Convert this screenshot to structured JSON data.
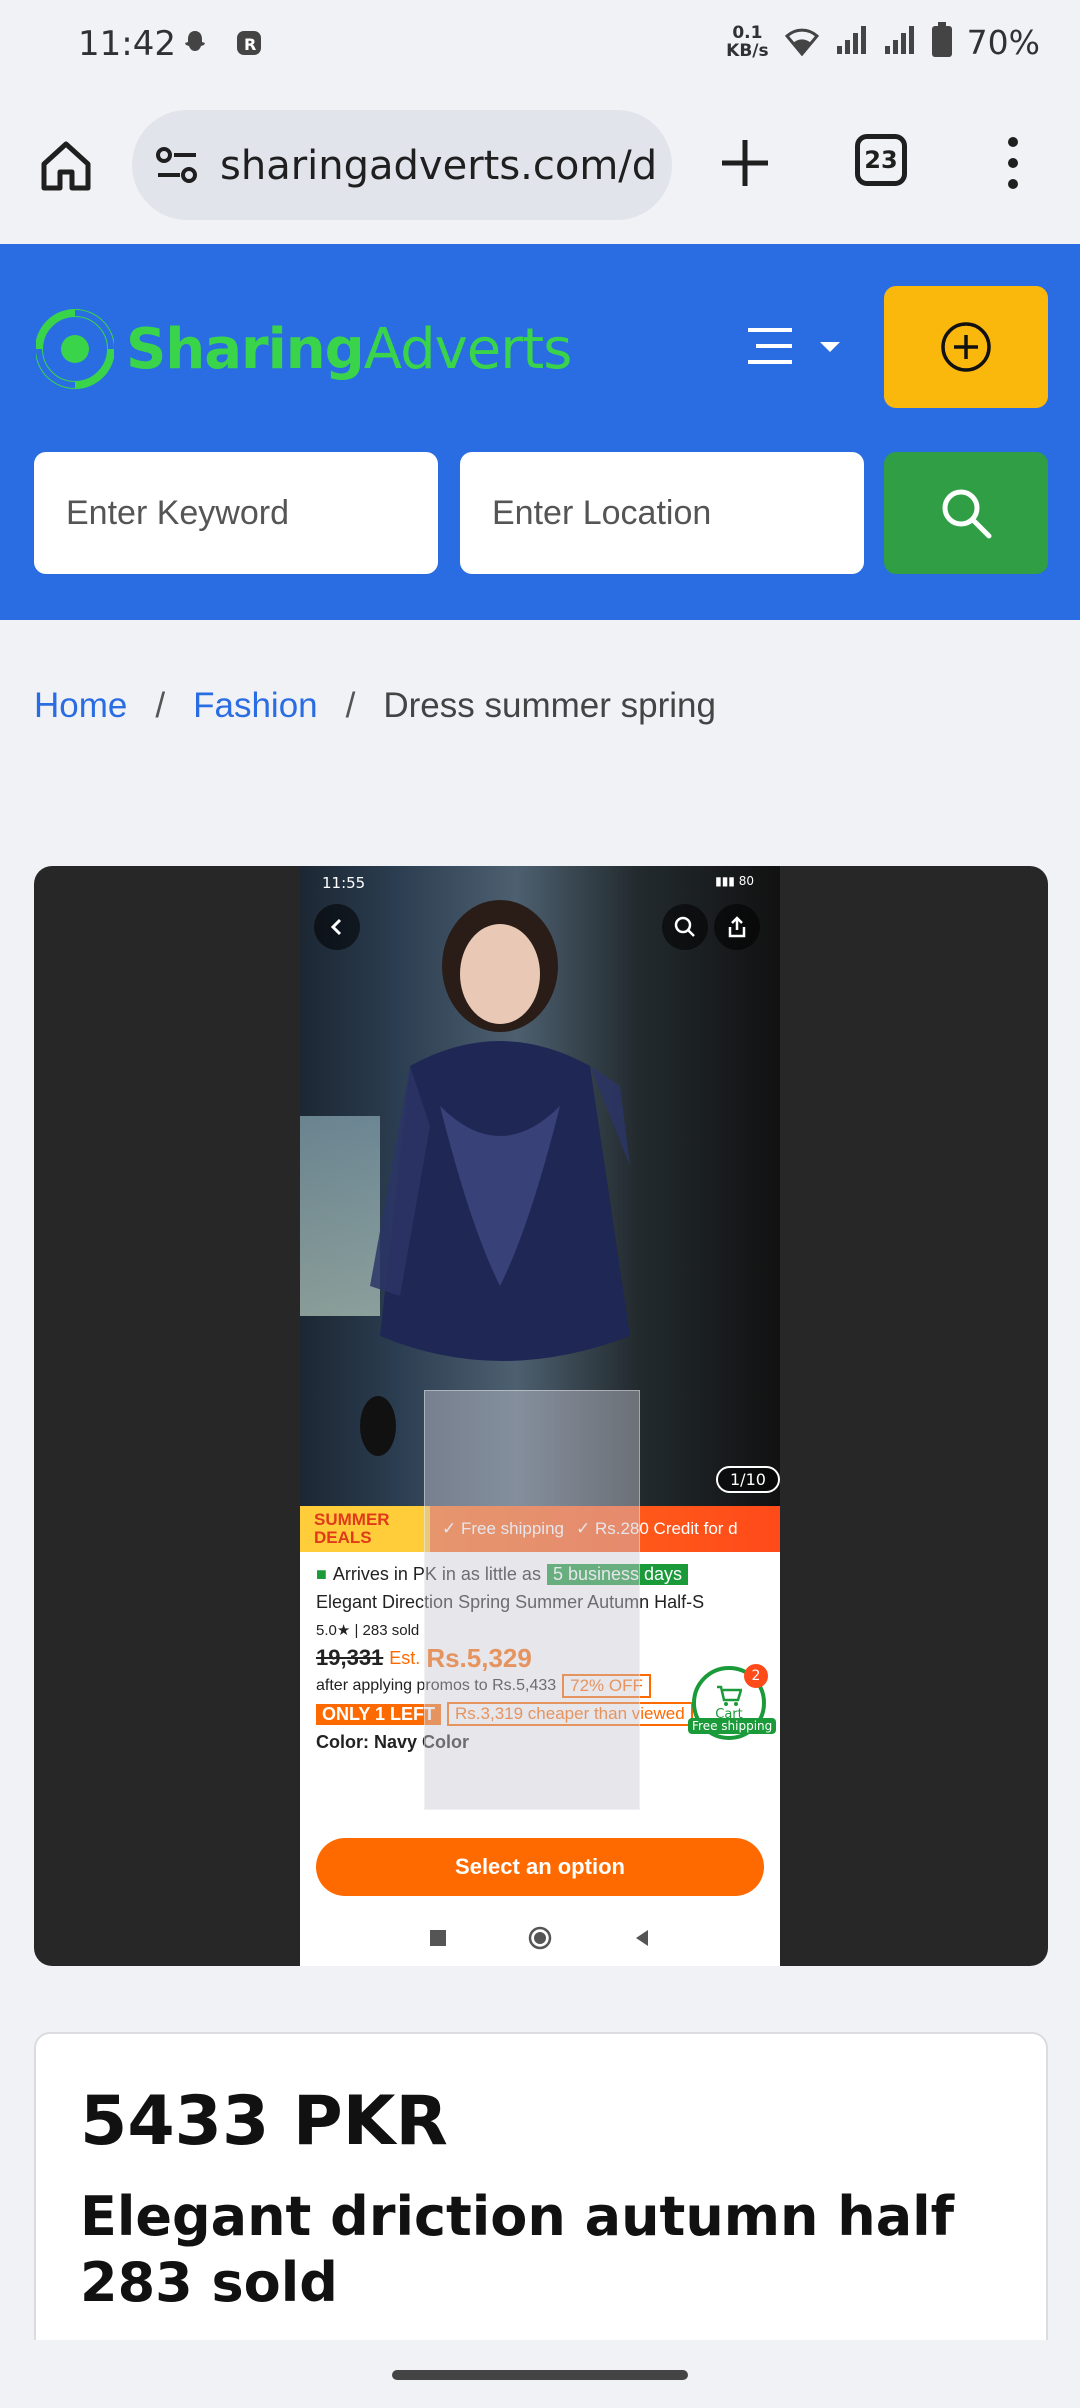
{
  "status_bar": {
    "time": "11:42",
    "net_speed_value": "0.1",
    "net_speed_unit": "KB/s",
    "battery": "70%"
  },
  "browser": {
    "url": "sharingadverts.com/d",
    "tab_count": "23"
  },
  "site": {
    "logo_bold": "Sharing",
    "logo_light": "Adverts",
    "brand_color": "#2a6de3",
    "accent_color": "#fbb80c",
    "search_color": "#2f9e44",
    "keyword_placeholder": "Enter Keyword",
    "location_placeholder": "Enter Location"
  },
  "breadcrumb": {
    "home": "Home",
    "category": "Fashion",
    "current": "Dress summer spring"
  },
  "screenshot": {
    "time": "11:55",
    "page_indicator": "1/10",
    "deals_line1": "SUMMER",
    "deals_line2": "DEALS",
    "free_shipping": "✓ Free shipping",
    "credit": "✓ Rs.280 Credit for d",
    "arrives_text": "Arrives in PK in as little as",
    "arrives_tag": "5 business days",
    "product_name": "Elegant Direction Spring Summer Autumn Half-S",
    "rating": "5.0★ | 283 sold",
    "old_price": "19,331",
    "est_label": "Est.",
    "new_price": "Rs.5,329",
    "promo_text": "after applying promos to Rs.5,433",
    "off_tag": "72% OFF",
    "only_left": "ONLY 1 LEFT",
    "cheaper": "Rs.3,319 cheaper than viewed",
    "color_label": "Color: Navy Color",
    "cart_count": "2",
    "cart_label": "Cart",
    "free_ship_label": "Free shipping",
    "select_option": "Select an option"
  },
  "product": {
    "price": "5433 PKR",
    "title": "Elegant driction autumn half 283 sold"
  }
}
